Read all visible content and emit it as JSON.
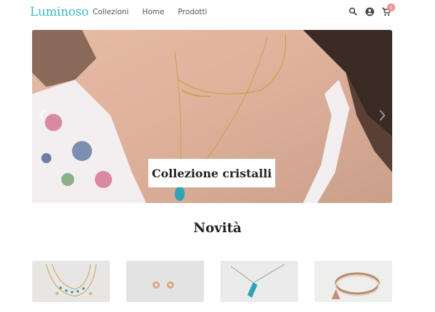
{
  "header": {
    "logo": "Luminoso",
    "nav": [
      "Collezioni",
      "Home",
      "Prodotti"
    ],
    "icons": [
      "search-icon",
      "account-icon",
      "cart-icon"
    ],
    "cart_count": "0"
  },
  "hero": {
    "caption": "Collezione cristalli",
    "prev_icon": "chevron-left-icon",
    "next_icon": "chevron-right-icon"
  },
  "section": {
    "title": "Novità"
  },
  "products": [
    {
      "name": "necklace-beads"
    },
    {
      "name": "earrings-studs"
    },
    {
      "name": "crystal-pendant"
    },
    {
      "name": "bracelet-tassels"
    }
  ],
  "colors": {
    "brand": "#3fb9c6",
    "badge": "#f08a8a"
  }
}
